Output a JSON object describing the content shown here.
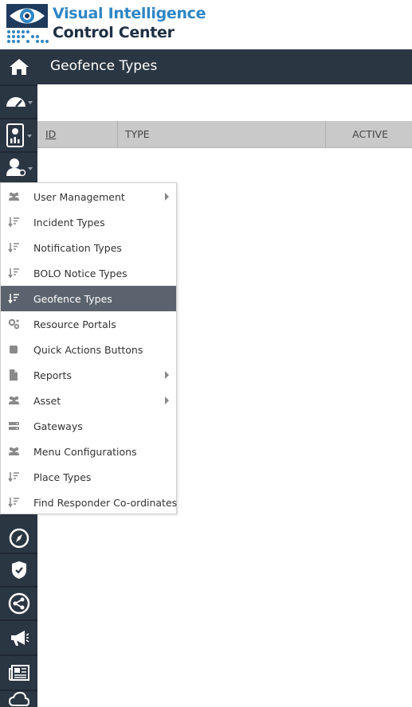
{
  "app": {
    "logo_line1": "Visual Intelligence",
    "logo_line2": "Control Center"
  },
  "header": {
    "title": "Geofence Types"
  },
  "table": {
    "columns": [
      "ID",
      "TYPE",
      "ACTIVE"
    ]
  },
  "sidebar": {
    "icons": [
      "home-icon",
      "dashboard-icon",
      "reports-icon",
      "admin-user-icon",
      "compass-icon",
      "shield-icon",
      "share-icon",
      "megaphone-icon",
      "news-icon",
      "cloud-icon"
    ]
  },
  "menu": {
    "items": [
      {
        "label": "User Management",
        "icon": "users-icon",
        "submenu": true
      },
      {
        "label": "Incident Types",
        "icon": "sort-icon",
        "submenu": false
      },
      {
        "label": "Notification Types",
        "icon": "sort-icon",
        "submenu": false
      },
      {
        "label": "BOLO Notice Types",
        "icon": "sort-icon",
        "submenu": false
      },
      {
        "label": "Geofence Types",
        "icon": "sort-icon",
        "submenu": false,
        "selected": true
      },
      {
        "label": "Resource Portals",
        "icon": "gears-icon",
        "submenu": false
      },
      {
        "label": "Quick Actions Buttons",
        "icon": "square-icon",
        "submenu": false
      },
      {
        "label": "Reports",
        "icon": "file-icon",
        "submenu": true
      },
      {
        "label": "Asset",
        "icon": "users-icon",
        "submenu": true
      },
      {
        "label": "Gateways",
        "icon": "server-icon",
        "submenu": false
      },
      {
        "label": "Menu Configurations",
        "icon": "users-icon",
        "submenu": false
      },
      {
        "label": "Place Types",
        "icon": "sort-icon",
        "submenu": false
      },
      {
        "label": "Find Responder Co-ordinates",
        "icon": "sort-icon",
        "submenu": false
      }
    ]
  },
  "colors": {
    "sidebar": "#2b3643",
    "selected": "#5b646e",
    "brand_blue": "#2f86c5",
    "brand_dark": "#1e2f44"
  }
}
